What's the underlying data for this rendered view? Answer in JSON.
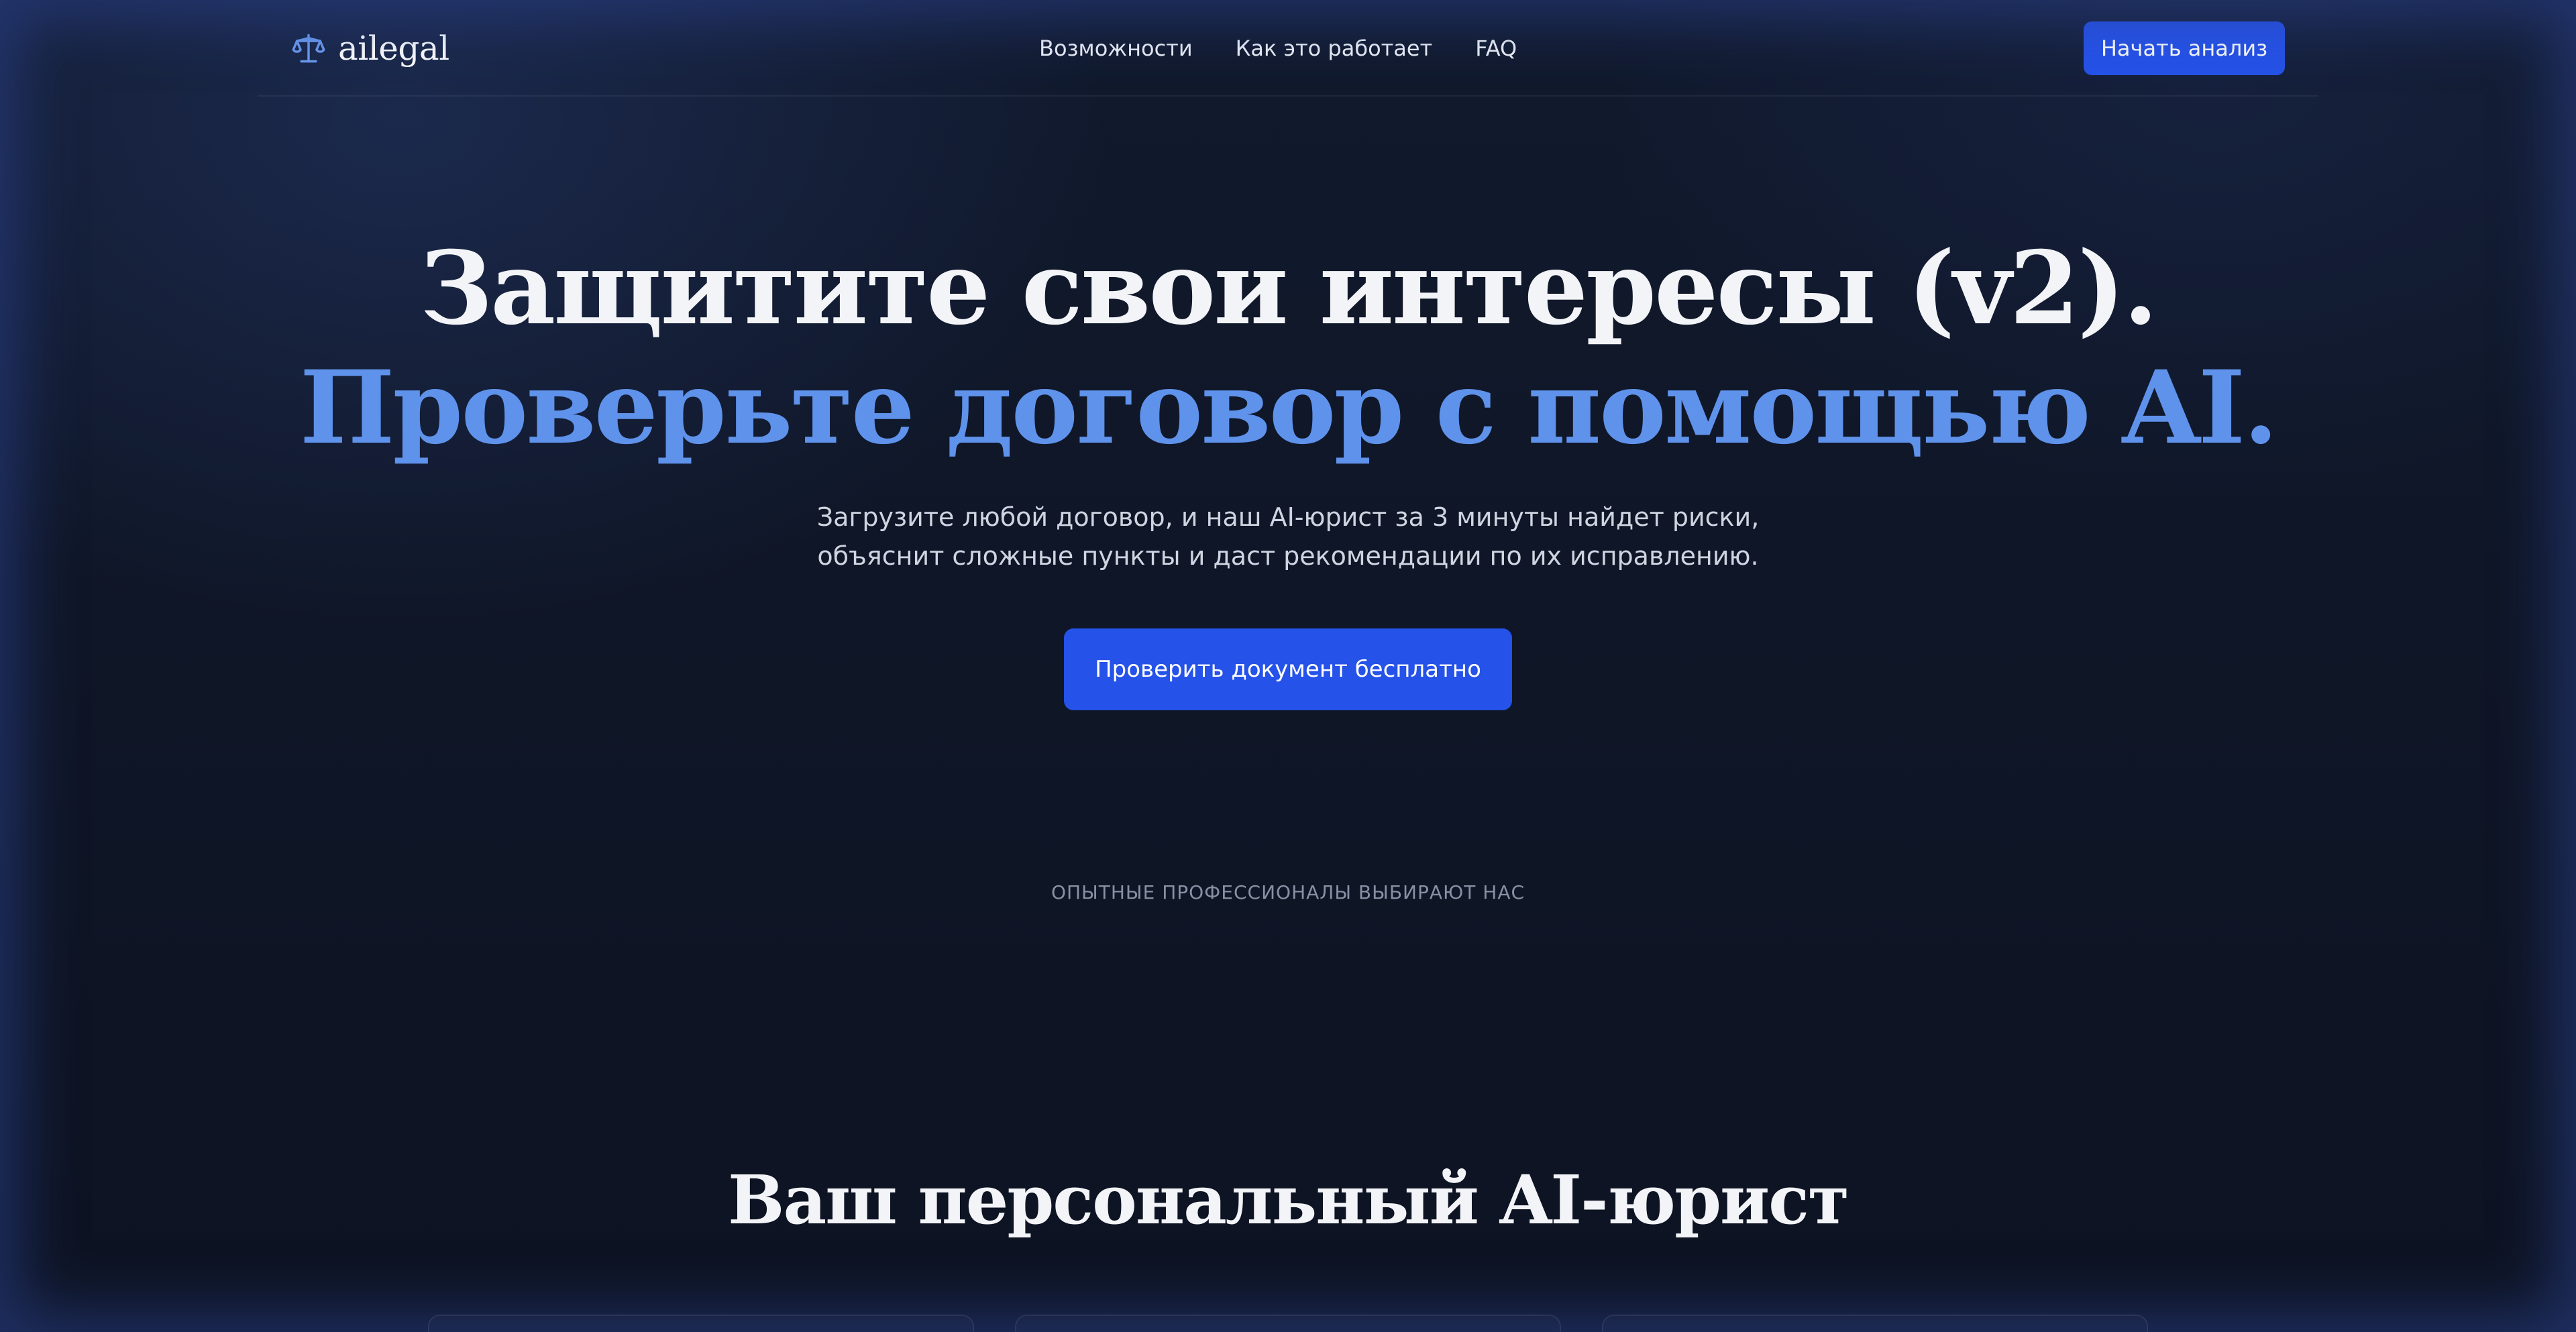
{
  "header": {
    "logo_text": "ailegal",
    "logo_icon": "scales-icon",
    "nav": [
      {
        "label": "Возможности"
      },
      {
        "label": "Как это работает"
      },
      {
        "label": "FAQ"
      }
    ],
    "cta_label": "Начать анализ"
  },
  "hero": {
    "title_line1": "Защитите свои интересы (v2).",
    "title_line2": "Проверьте договор с помощью AI.",
    "subtitle": "Загрузите любой договор, и наш AI-юрист за 3 минуты найдет риски, объяснит сложные пункты и даст рекомендации по их исправлению.",
    "cta_label": "Проверить документ бесплатно"
  },
  "trust": {
    "label": "ОПЫТНЫЕ ПРОФЕССИОНАЛЫ ВЫБИРАЮТ НАС"
  },
  "features": {
    "title": "Ваш персональный AI-юрист"
  },
  "colors": {
    "accent": "#2552e8",
    "highlight": "#5f92ea",
    "background": "#0d1322"
  }
}
